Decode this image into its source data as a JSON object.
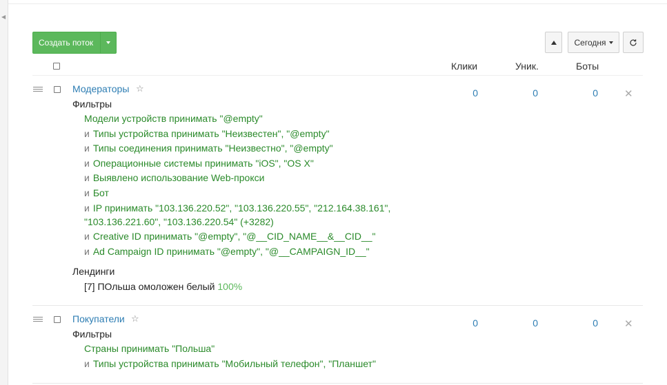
{
  "toolbar": {
    "create_label": "Создать поток",
    "date_label": "Сегодня",
    "refresh_icon": "refresh-icon",
    "sort_icon": "sort-up-icon"
  },
  "columns": {
    "clicks": "Клики",
    "unique": "Уник.",
    "bots": "Боты"
  },
  "flows": [
    {
      "name": "Модераторы",
      "clicks": "0",
      "unique": "0",
      "bots": "0",
      "filters_label": "Фильтры",
      "filters": [
        {
          "and": "",
          "text": "Модели устройств принимать \"@empty\""
        },
        {
          "and": "и",
          "text": "Типы устройства принимать \"Неизвестен\", \"@empty\""
        },
        {
          "and": "и",
          "text": "Типы соединения принимать \"Неизвестно\", \"@empty\""
        },
        {
          "and": "и",
          "text": "Операционные системы принимать \"iOS\", \"OS X\""
        },
        {
          "and": "и",
          "text": "Выявлено использование Web-прокси"
        },
        {
          "and": "и",
          "text": "Бот"
        },
        {
          "and": "и",
          "text": "IP принимать \"103.136.220.52\", \"103.136.220.55\", \"212.164.38.161\","
        },
        {
          "and": "",
          "text": "\"103.136.221.60\", \"103.136.220.54\" (+3282)"
        },
        {
          "and": "и",
          "text": "Creative ID принимать \"@empty\", \"@__CID_NAME__&__CID__\""
        },
        {
          "and": "и",
          "text": "Ad Campaign ID принимать \"@empty\", \"@__CAMPAIGN_ID__\""
        }
      ],
      "landings_label": "Лендинги",
      "landing": "[7] ПОльша омоложен белый",
      "landing_pct": "100%"
    },
    {
      "name": "Покупатели",
      "clicks": "0",
      "unique": "0",
      "bots": "0",
      "filters_label": "Фильтры",
      "filters": [
        {
          "and": "",
          "text": "Страны принимать \"Польша\""
        },
        {
          "and": "и",
          "text": "Типы устройства принимать \"Мобильный телефон\", \"Планшет\""
        }
      ]
    }
  ]
}
